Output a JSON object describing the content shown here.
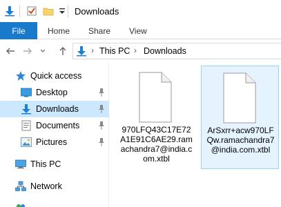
{
  "window": {
    "title": "Downloads"
  },
  "quick_access_toolbar": {
    "icons": [
      "download-arrow-icon",
      "properties-check-icon",
      "new-folder-icon",
      "customize-dropdown-icon"
    ]
  },
  "ribbon": {
    "tabs": [
      {
        "label": "File",
        "active": true
      },
      {
        "label": "Home"
      },
      {
        "label": "Share"
      },
      {
        "label": "View"
      }
    ]
  },
  "address_bar": {
    "crumbs": [
      "This PC",
      "Downloads"
    ]
  },
  "nav_pane": {
    "items": [
      {
        "label": "Quick access",
        "icon": "star-icon"
      },
      {
        "label": "Desktop",
        "icon": "desktop-folder-icon",
        "pinned": true
      },
      {
        "label": "Downloads",
        "icon": "download-arrow-icon",
        "pinned": true,
        "selected": true
      },
      {
        "label": "Documents",
        "icon": "documents-icon",
        "pinned": true
      },
      {
        "label": "Pictures",
        "icon": "pictures-icon",
        "pinned": true
      },
      {
        "label": "This PC",
        "icon": "computer-icon"
      },
      {
        "label": "Network",
        "icon": "network-icon"
      }
    ]
  },
  "files": [
    {
      "name": "970LFQ43C17E72A1E91C6AE29.ramachandra7@india.com.xtbl",
      "selected": false
    },
    {
      "name": "ArSxrr+acw970LFQw.ramachandra7@india.com.xtbl",
      "selected": true
    }
  ],
  "colors": {
    "accent": "#1979ca",
    "selection": "#cce8ff",
    "tile_selection": "#e5f3ff",
    "tile_border": "#99d1ff"
  }
}
